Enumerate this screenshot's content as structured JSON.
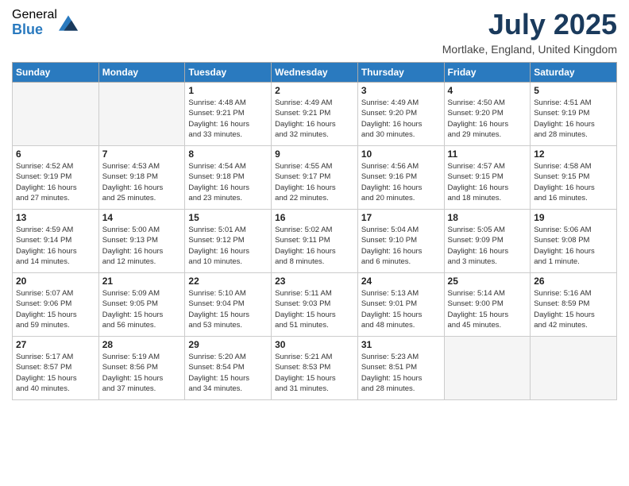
{
  "logo": {
    "general": "General",
    "blue": "Blue"
  },
  "title": "July 2025",
  "location": "Mortlake, England, United Kingdom",
  "days_header": [
    "Sunday",
    "Monday",
    "Tuesday",
    "Wednesday",
    "Thursday",
    "Friday",
    "Saturday"
  ],
  "weeks": [
    [
      {
        "day": "",
        "info": ""
      },
      {
        "day": "",
        "info": ""
      },
      {
        "day": "1",
        "info": "Sunrise: 4:48 AM\nSunset: 9:21 PM\nDaylight: 16 hours\nand 33 minutes."
      },
      {
        "day": "2",
        "info": "Sunrise: 4:49 AM\nSunset: 9:21 PM\nDaylight: 16 hours\nand 32 minutes."
      },
      {
        "day": "3",
        "info": "Sunrise: 4:49 AM\nSunset: 9:20 PM\nDaylight: 16 hours\nand 30 minutes."
      },
      {
        "day": "4",
        "info": "Sunrise: 4:50 AM\nSunset: 9:20 PM\nDaylight: 16 hours\nand 29 minutes."
      },
      {
        "day": "5",
        "info": "Sunrise: 4:51 AM\nSunset: 9:19 PM\nDaylight: 16 hours\nand 28 minutes."
      }
    ],
    [
      {
        "day": "6",
        "info": "Sunrise: 4:52 AM\nSunset: 9:19 PM\nDaylight: 16 hours\nand 27 minutes."
      },
      {
        "day": "7",
        "info": "Sunrise: 4:53 AM\nSunset: 9:18 PM\nDaylight: 16 hours\nand 25 minutes."
      },
      {
        "day": "8",
        "info": "Sunrise: 4:54 AM\nSunset: 9:18 PM\nDaylight: 16 hours\nand 23 minutes."
      },
      {
        "day": "9",
        "info": "Sunrise: 4:55 AM\nSunset: 9:17 PM\nDaylight: 16 hours\nand 22 minutes."
      },
      {
        "day": "10",
        "info": "Sunrise: 4:56 AM\nSunset: 9:16 PM\nDaylight: 16 hours\nand 20 minutes."
      },
      {
        "day": "11",
        "info": "Sunrise: 4:57 AM\nSunset: 9:15 PM\nDaylight: 16 hours\nand 18 minutes."
      },
      {
        "day": "12",
        "info": "Sunrise: 4:58 AM\nSunset: 9:15 PM\nDaylight: 16 hours\nand 16 minutes."
      }
    ],
    [
      {
        "day": "13",
        "info": "Sunrise: 4:59 AM\nSunset: 9:14 PM\nDaylight: 16 hours\nand 14 minutes."
      },
      {
        "day": "14",
        "info": "Sunrise: 5:00 AM\nSunset: 9:13 PM\nDaylight: 16 hours\nand 12 minutes."
      },
      {
        "day": "15",
        "info": "Sunrise: 5:01 AM\nSunset: 9:12 PM\nDaylight: 16 hours\nand 10 minutes."
      },
      {
        "day": "16",
        "info": "Sunrise: 5:02 AM\nSunset: 9:11 PM\nDaylight: 16 hours\nand 8 minutes."
      },
      {
        "day": "17",
        "info": "Sunrise: 5:04 AM\nSunset: 9:10 PM\nDaylight: 16 hours\nand 6 minutes."
      },
      {
        "day": "18",
        "info": "Sunrise: 5:05 AM\nSunset: 9:09 PM\nDaylight: 16 hours\nand 3 minutes."
      },
      {
        "day": "19",
        "info": "Sunrise: 5:06 AM\nSunset: 9:08 PM\nDaylight: 16 hours\nand 1 minute."
      }
    ],
    [
      {
        "day": "20",
        "info": "Sunrise: 5:07 AM\nSunset: 9:06 PM\nDaylight: 15 hours\nand 59 minutes."
      },
      {
        "day": "21",
        "info": "Sunrise: 5:09 AM\nSunset: 9:05 PM\nDaylight: 15 hours\nand 56 minutes."
      },
      {
        "day": "22",
        "info": "Sunrise: 5:10 AM\nSunset: 9:04 PM\nDaylight: 15 hours\nand 53 minutes."
      },
      {
        "day": "23",
        "info": "Sunrise: 5:11 AM\nSunset: 9:03 PM\nDaylight: 15 hours\nand 51 minutes."
      },
      {
        "day": "24",
        "info": "Sunrise: 5:13 AM\nSunset: 9:01 PM\nDaylight: 15 hours\nand 48 minutes."
      },
      {
        "day": "25",
        "info": "Sunrise: 5:14 AM\nSunset: 9:00 PM\nDaylight: 15 hours\nand 45 minutes."
      },
      {
        "day": "26",
        "info": "Sunrise: 5:16 AM\nSunset: 8:59 PM\nDaylight: 15 hours\nand 42 minutes."
      }
    ],
    [
      {
        "day": "27",
        "info": "Sunrise: 5:17 AM\nSunset: 8:57 PM\nDaylight: 15 hours\nand 40 minutes."
      },
      {
        "day": "28",
        "info": "Sunrise: 5:19 AM\nSunset: 8:56 PM\nDaylight: 15 hours\nand 37 minutes."
      },
      {
        "day": "29",
        "info": "Sunrise: 5:20 AM\nSunset: 8:54 PM\nDaylight: 15 hours\nand 34 minutes."
      },
      {
        "day": "30",
        "info": "Sunrise: 5:21 AM\nSunset: 8:53 PM\nDaylight: 15 hours\nand 31 minutes."
      },
      {
        "day": "31",
        "info": "Sunrise: 5:23 AM\nSunset: 8:51 PM\nDaylight: 15 hours\nand 28 minutes."
      },
      {
        "day": "",
        "info": ""
      },
      {
        "day": "",
        "info": ""
      }
    ]
  ]
}
